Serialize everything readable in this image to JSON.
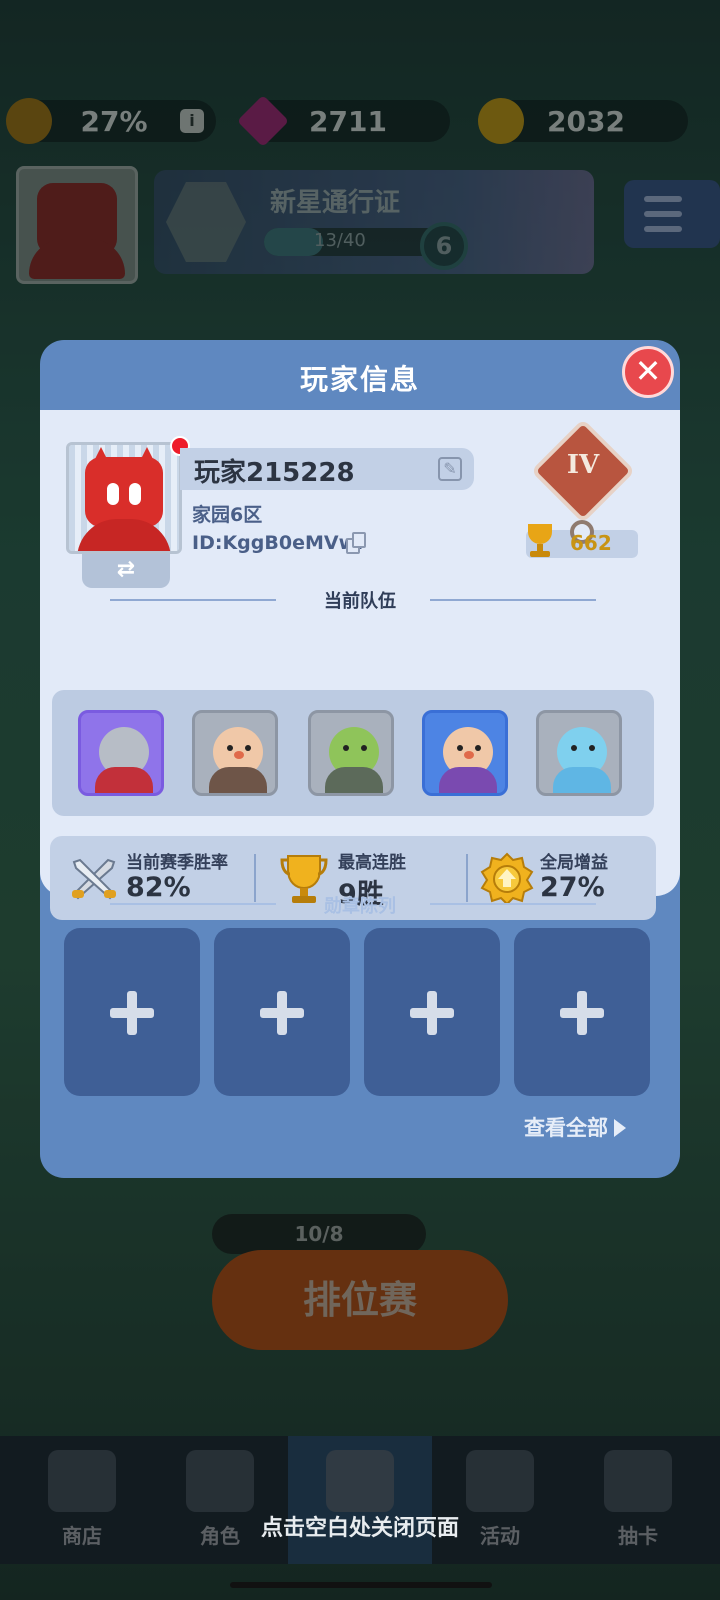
{
  "resources": {
    "boost_percent": "27%",
    "gems": "2711",
    "coins": "2032",
    "info_glyph": "i"
  },
  "pass": {
    "title": "新星通行证",
    "progress": "13/40",
    "progress_fraction": 0.325,
    "level": "6"
  },
  "ranked": {
    "tickets": "10/8",
    "button_label": "排位赛"
  },
  "nav": {
    "items": [
      {
        "label": "商店",
        "icon": "shop-icon"
      },
      {
        "label": "角色",
        "icon": "character-cards-icon"
      },
      {
        "label": "",
        "icon": "crossed-swords-icon",
        "active": true
      },
      {
        "label": "活动",
        "icon": "star-shield-icon"
      },
      {
        "label": "抽卡",
        "icon": "mystery-box-icon"
      }
    ]
  },
  "close_hint": "点击空白处关闭页面",
  "modal": {
    "title": "玩家信息",
    "close_glyph": "✕",
    "player": {
      "name": "玩家215228",
      "server": "家园6区",
      "id": "ID:KggB0eMVwf",
      "rank": "IV",
      "trophies": "662"
    },
    "swap_glyph": "⇄",
    "team_title": "当前队伍",
    "team": [
      {
        "name": "knight",
        "frame": "#7a5be0",
        "bg": "#8f74ea"
      },
      {
        "name": "brawler",
        "frame": "#8d96a4",
        "bg": "#a9b1bd"
      },
      {
        "name": "goblin",
        "frame": "#8d96a4",
        "bg": "#a9b1bd"
      },
      {
        "name": "mage",
        "frame": "#3a6fd6",
        "bg": "#4d84e4"
      },
      {
        "name": "ice-mage",
        "frame": "#8d96a4",
        "bg": "#a9b1bd"
      }
    ],
    "stats": [
      {
        "label": "当前赛季胜率",
        "value": "82%",
        "icon": "crossed-swords-icon"
      },
      {
        "label": "最高连胜",
        "value": "9胜",
        "icon": "trophy-icon"
      },
      {
        "label": "全局增益",
        "value": "27%",
        "icon": "boost-badge-icon"
      }
    ],
    "medal_title": "勋章陈列",
    "medal_slots": 4,
    "view_all": "查看全部"
  },
  "colors": {
    "modal_header": "#5f88c0",
    "panel": "#e2eaf8",
    "close_button": "#e8484d",
    "medal_slot": "#3f5f96",
    "trophy_gold": "#c89414"
  }
}
